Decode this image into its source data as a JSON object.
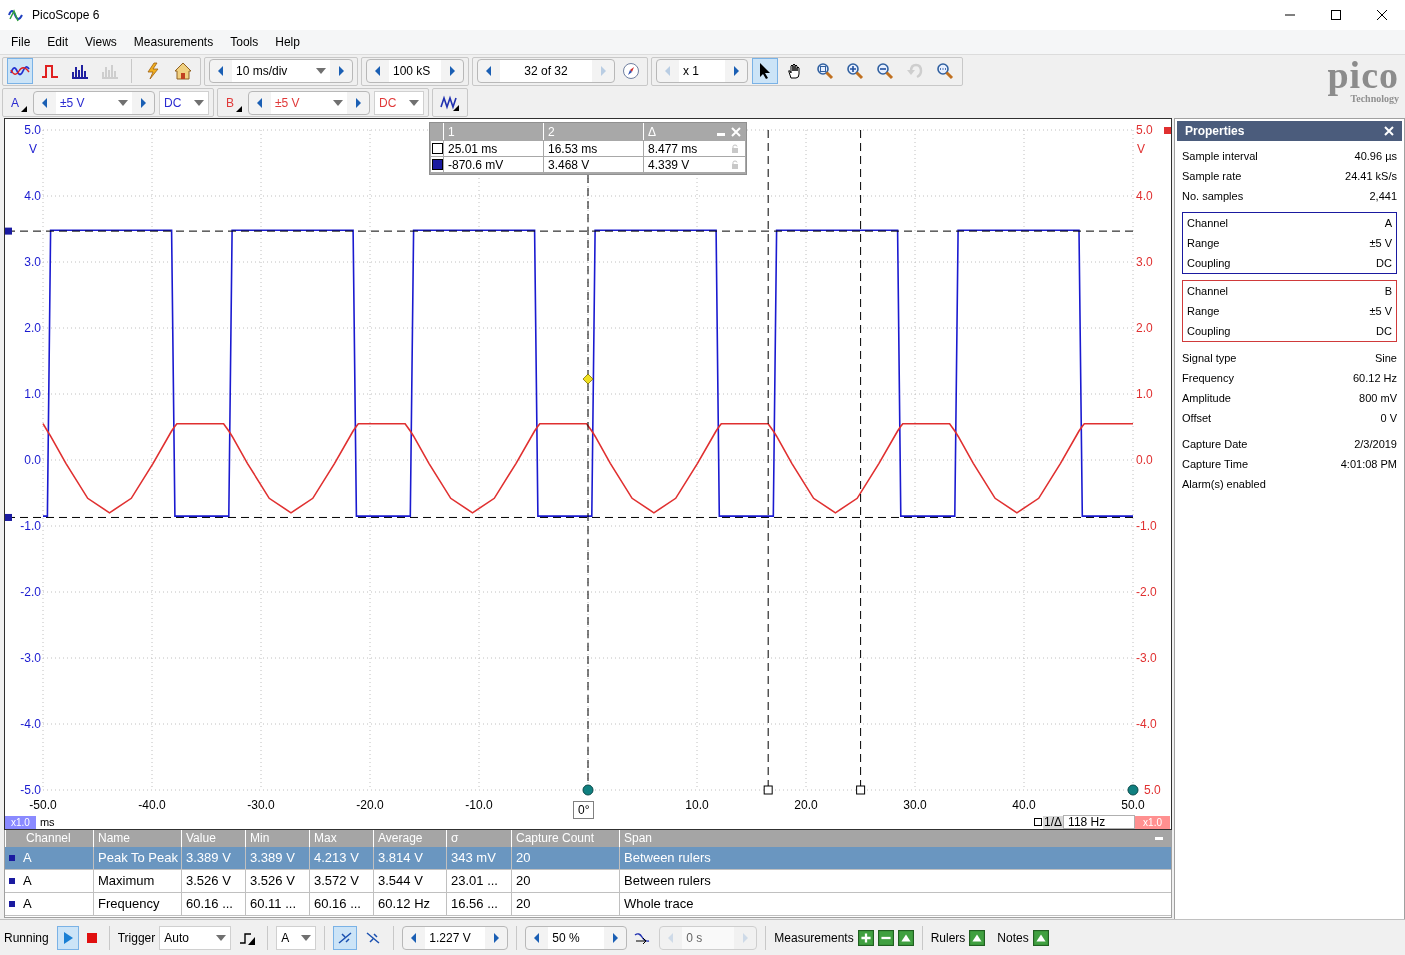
{
  "window": {
    "title": "PicoScope 6"
  },
  "menu": [
    "File",
    "Edit",
    "Views",
    "Measurements",
    "Tools",
    "Help"
  ],
  "toolbar": {
    "view_modes": [
      {
        "kind": "scope",
        "selected": true,
        "disabled": false
      },
      {
        "kind": "persistence",
        "selected": false,
        "disabled": false
      },
      {
        "kind": "spectrum",
        "selected": false,
        "disabled": false
      },
      {
        "kind": "spectrum",
        "selected": false,
        "disabled": true
      }
    ],
    "actions": [
      {
        "kind": "auto-setup"
      },
      {
        "kind": "home"
      }
    ],
    "timebase": {
      "value": "10 ms/div",
      "dropdown": true,
      "prev_disabled": false,
      "next_disabled": false
    },
    "samples": {
      "value": "100 kS",
      "dropdown": false,
      "prev_disabled": false,
      "next_disabled": false
    },
    "buffer": {
      "value": "32 of 32",
      "dropdown": false,
      "prev_disabled": false,
      "next_disabled": true
    },
    "zoom": {
      "value": "x 1",
      "dropdown": false,
      "prev_disabled": true,
      "next_disabled": false
    },
    "tools": [
      {
        "kind": "pointer",
        "selected": true,
        "disabled": false
      },
      {
        "kind": "hand",
        "selected": false,
        "disabled": false
      },
      {
        "kind": "zoom-fit",
        "selected": false,
        "disabled": false
      },
      {
        "kind": "zoom-in",
        "selected": false,
        "disabled": false
      },
      {
        "kind": "zoom-out",
        "selected": false,
        "disabled": false
      },
      {
        "kind": "undo",
        "selected": false,
        "disabled": true
      },
      {
        "kind": "zoom-overview",
        "selected": false,
        "disabled": false
      }
    ]
  },
  "channels": [
    {
      "name": "A",
      "color": "#2a2ad0",
      "range": {
        "value": "±5 V",
        "dropdown": true,
        "prev_disabled": false,
        "next_disabled": false
      },
      "coupling": "DC"
    },
    {
      "name": "B",
      "color": "#e03a3a",
      "range": {
        "value": "±5 V",
        "dropdown": true,
        "prev_disabled": false,
        "next_disabled": false
      },
      "coupling": "DC"
    }
  ],
  "logo": {
    "name": "pico",
    "tagline": "Technology"
  },
  "scope": {
    "chart_data": {
      "type": "line",
      "xlabel": "ms",
      "ylabel": "V",
      "xlim": [
        -50,
        50
      ],
      "ylim": [
        -5,
        5
      ],
      "xticks": [
        {
          "value": -50,
          "label": "-50.0"
        },
        {
          "value": -40,
          "label": "-40.0"
        },
        {
          "value": -30,
          "label": "-30.0"
        },
        {
          "value": -20,
          "label": "-20.0"
        },
        {
          "value": -10,
          "label": "-10.0"
        },
        {
          "value": 10,
          "label": "10.0"
        },
        {
          "value": 20,
          "label": "20.0"
        },
        {
          "value": 30,
          "label": "30.0"
        },
        {
          "value": 40,
          "label": "40.0"
        },
        {
          "value": 50,
          "label": "50.0"
        }
      ],
      "yticks": [
        {
          "value": 5,
          "label": "5.0"
        },
        {
          "value": 4,
          "label": "4.0"
        },
        {
          "value": 3,
          "label": "3.0"
        },
        {
          "value": 2,
          "label": "2.0"
        },
        {
          "value": 1,
          "label": "1.0"
        },
        {
          "value": 0,
          "label": "0.0"
        },
        {
          "value": -1,
          "label": "-1.0"
        },
        {
          "value": -2,
          "label": "-2.0"
        },
        {
          "value": -3,
          "label": "-3.0"
        },
        {
          "value": -4,
          "label": "-4.0"
        },
        {
          "value": -5,
          "label": "-5.0"
        }
      ],
      "x": [
        -50,
        -49.6,
        -49.3,
        -47.9,
        -45.9,
        -43.9,
        -41.9,
        -39.9,
        -38.2,
        -37.9,
        -37.72,
        -33.43,
        -32.95,
        -32.65,
        -31.25,
        -29.25,
        -27.25,
        -25.25,
        -23.25,
        -21.55,
        -21.25,
        -21.07,
        -16.78,
        -16.3,
        -16,
        -14.6,
        -12.6,
        -10.6,
        -8.6,
        -6.6,
        -4.9,
        -4.6,
        -4.42,
        -0.13,
        0.35,
        0.65,
        2.05,
        4.05,
        6.05,
        8.05,
        10.05,
        11.75,
        12.05,
        12.23,
        16.52,
        17,
        17.3,
        18.7,
        20.7,
        22.7,
        24.7,
        26.7,
        28.4,
        28.7,
        28.88,
        33.17,
        33.65,
        33.95,
        35.35,
        37.35,
        39.35,
        41.35,
        43.35,
        45.05,
        45.35,
        45.53,
        49.82,
        50
      ],
      "series": [
        {
          "color": "#1a1ad0",
          "values": [
            -0.85,
            -0.85,
            3.48,
            3.48,
            3.48,
            3.48,
            3.48,
            3.48,
            3.48,
            -0.85,
            -0.85,
            -0.85,
            -0.85,
            3.48,
            3.48,
            3.48,
            3.48,
            3.48,
            3.48,
            3.48,
            -0.85,
            -0.85,
            -0.85,
            -0.85,
            3.48,
            3.48,
            3.48,
            3.48,
            3.48,
            3.48,
            3.48,
            -0.85,
            -0.85,
            -0.85,
            -0.85,
            3.48,
            3.48,
            3.48,
            3.48,
            3.48,
            3.48,
            3.48,
            -0.85,
            -0.85,
            -0.85,
            -0.85,
            3.48,
            3.48,
            3.48,
            3.48,
            3.48,
            3.48,
            3.48,
            -0.85,
            -0.85,
            -0.85,
            -0.85,
            3.48,
            3.48,
            3.48,
            3.48,
            3.48,
            3.48,
            3.48,
            -0.85,
            -0.85,
            -0.85,
            -0.85
          ]
        },
        {
          "color": "#e03030",
          "values": [
            0.55,
            0.44,
            0.36,
            -0.05,
            -0.58,
            -0.8,
            -0.58,
            -0.05,
            0.44,
            0.51,
            0.55,
            0.55,
            0.44,
            0.36,
            -0.05,
            -0.58,
            -0.8,
            -0.58,
            -0.05,
            0.44,
            0.51,
            0.55,
            0.55,
            0.44,
            0.36,
            -0.05,
            -0.58,
            -0.8,
            -0.58,
            -0.05,
            0.44,
            0.51,
            0.55,
            0.55,
            0.44,
            0.36,
            -0.05,
            -0.58,
            -0.8,
            -0.58,
            -0.05,
            0.44,
            0.51,
            0.55,
            0.55,
            0.44,
            0.36,
            -0.05,
            -0.58,
            -0.8,
            -0.58,
            -0.05,
            0.44,
            0.51,
            0.55,
            0.55,
            0.44,
            0.36,
            -0.05,
            -0.58,
            -0.8,
            -0.58,
            -0.05,
            0.44,
            0.51,
            0.55,
            0.55,
            0.55
          ]
        }
      ],
      "grid": true
    },
    "right_ticks": [
      "5.0",
      "4.0",
      "3.0",
      "2.0",
      "1.0",
      "0.0",
      "-1.0",
      "-2.0",
      "-3.0",
      "-4.0",
      "5.0"
    ],
    "right_unit": "V",
    "trigger_phase": "0°",
    "left_scale": "x1.0",
    "right_scale": "x1.0",
    "frequency_label": "1/Δ",
    "frequency": "118 Hz",
    "readout": {
      "columns": [
        "1",
        "2",
        "Δ"
      ],
      "rows": [
        {
          "color": "#ffffff",
          "cells": [
            "25.01 ms",
            "16.53 ms",
            "8.477 ms"
          ]
        },
        {
          "color": "#1a1aa0",
          "cells": [
            "-870.6 mV",
            "3.468 V",
            "4.339 V"
          ]
        }
      ]
    }
  },
  "properties": {
    "title": "Properties",
    "sections": [
      {
        "kind": "plain",
        "rows": [
          {
            "label": "Sample interval",
            "value": "40.96 µs"
          },
          {
            "label": "Sample rate",
            "value": "24.41 kS/s"
          },
          {
            "label": "No. samples",
            "value": "2,441"
          }
        ]
      },
      {
        "kind": "boxed",
        "color": "#1a1aa0",
        "rows": [
          {
            "label": "Channel",
            "value": "A"
          },
          {
            "label": "Range",
            "value": "±5 V"
          },
          {
            "label": "Coupling",
            "value": "DC"
          }
        ]
      },
      {
        "kind": "boxed",
        "color": "#d03a3a",
        "rows": [
          {
            "label": "Channel",
            "value": "B"
          },
          {
            "label": "Range",
            "value": "±5 V"
          },
          {
            "label": "Coupling",
            "value": "DC"
          }
        ]
      },
      {
        "kind": "plain",
        "rows": [
          {
            "label": "Signal type",
            "value": "Sine"
          },
          {
            "label": "Frequency",
            "value": "60.12 Hz"
          },
          {
            "label": "Amplitude",
            "value": "800 mV"
          },
          {
            "label": "Offset",
            "value": "0 V"
          }
        ]
      },
      {
        "kind": "plain",
        "rows": [
          {
            "label": "Capture Date",
            "value": "2/3/2019"
          },
          {
            "label": "Capture Time",
            "value": "4:01:08 PM"
          },
          {
            "label": "Alarm(s) enabled"
          }
        ]
      }
    ]
  },
  "measurements": {
    "columns": [
      "Channel",
      "Name",
      "Value",
      "Min",
      "Max",
      "Average",
      "σ",
      "Capture Count",
      "Span"
    ],
    "rows": [
      {
        "selected": true,
        "cells": [
          "A",
          "Peak To Peak",
          "3.389 V",
          "3.389 V",
          "4.213 V",
          "3.814 V",
          "343 mV",
          "20",
          "Between rulers"
        ]
      },
      {
        "selected": false,
        "cells": [
          "A",
          "Maximum",
          "3.526 V",
          "3.526 V",
          "3.572 V",
          "3.544 V",
          "23.01 ...",
          "20",
          "Between rulers"
        ]
      },
      {
        "selected": false,
        "cells": [
          "A",
          "Frequency",
          "60.16 ...",
          "60.11 ...",
          "60.16 ...",
          "60.12 Hz",
          "16.56 ...",
          "20",
          "Whole trace"
        ]
      }
    ]
  },
  "status_bar": {
    "run_label": "Running",
    "running": true,
    "trigger_label": "Trigger",
    "trigger_mode": "Auto",
    "trigger_channel": "A",
    "edges": [
      {
        "kind": "rising",
        "selected": true
      },
      {
        "kind": "falling",
        "selected": false
      }
    ],
    "level": {
      "value": "1.227 V",
      "dropdown": false,
      "prev_disabled": false,
      "next_disabled": false
    },
    "pretrigger": {
      "value": "50 %",
      "dropdown": false,
      "prev_disabled": false,
      "next_disabled": false
    },
    "delay": {
      "value": "0 s",
      "dropdown": false,
      "prev_disabled": true,
      "next_disabled": true
    },
    "measurements_label": "Measurements",
    "rulers_label": "Rulers",
    "notes_label": "Notes"
  }
}
